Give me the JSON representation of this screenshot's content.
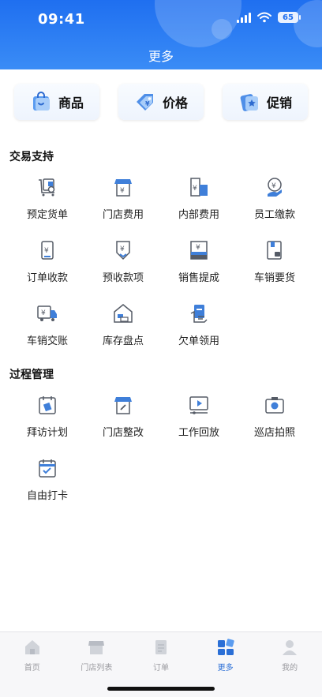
{
  "status": {
    "time": "09:41",
    "battery": "65"
  },
  "header": {
    "title": "更多"
  },
  "top_cards": [
    {
      "label": "商品",
      "icon": "bag-icon"
    },
    {
      "label": "价格",
      "icon": "price-tag-icon"
    },
    {
      "label": "促销",
      "icon": "promo-icon"
    }
  ],
  "sections": [
    {
      "title": "交易支持",
      "items": [
        {
          "label": "预定货单",
          "icon": "order-cart-icon"
        },
        {
          "label": "门店费用",
          "icon": "store-fee-icon"
        },
        {
          "label": "内部费用",
          "icon": "internal-fee-icon"
        },
        {
          "label": "员工缴款",
          "icon": "payment-icon"
        },
        {
          "label": "订单收款",
          "icon": "order-receipt-icon"
        },
        {
          "label": "预收款项",
          "icon": "prepay-icon"
        },
        {
          "label": "销售提成",
          "icon": "commission-icon"
        },
        {
          "label": "车销要货",
          "icon": "van-request-icon"
        },
        {
          "label": "车销交账",
          "icon": "truck-icon"
        },
        {
          "label": "库存盘点",
          "icon": "warehouse-icon"
        },
        {
          "label": "欠单领用",
          "icon": "debt-form-icon"
        }
      ]
    },
    {
      "title": "过程管理",
      "items": [
        {
          "label": "拜访计划",
          "icon": "calendar-plan-icon"
        },
        {
          "label": "门店整改",
          "icon": "store-fix-icon"
        },
        {
          "label": "工作回放",
          "icon": "video-play-icon"
        },
        {
          "label": "巡店拍照",
          "icon": "camera-icon"
        },
        {
          "label": "自由打卡",
          "icon": "calendar-check-icon"
        }
      ]
    }
  ],
  "tabbar": {
    "items": [
      {
        "label": "首页",
        "icon": "home-icon"
      },
      {
        "label": "门店列表",
        "icon": "store-list-icon"
      },
      {
        "label": "订单",
        "icon": "order-icon"
      },
      {
        "label": "更多",
        "icon": "grid-more-icon",
        "active": true
      },
      {
        "label": "我的",
        "icon": "user-icon"
      }
    ]
  },
  "colors": {
    "primary": "#1f6ff0",
    "icon_blue": "#3f7fd9",
    "icon_gray": "#555b66",
    "active_tab": "#2b6fd6"
  }
}
